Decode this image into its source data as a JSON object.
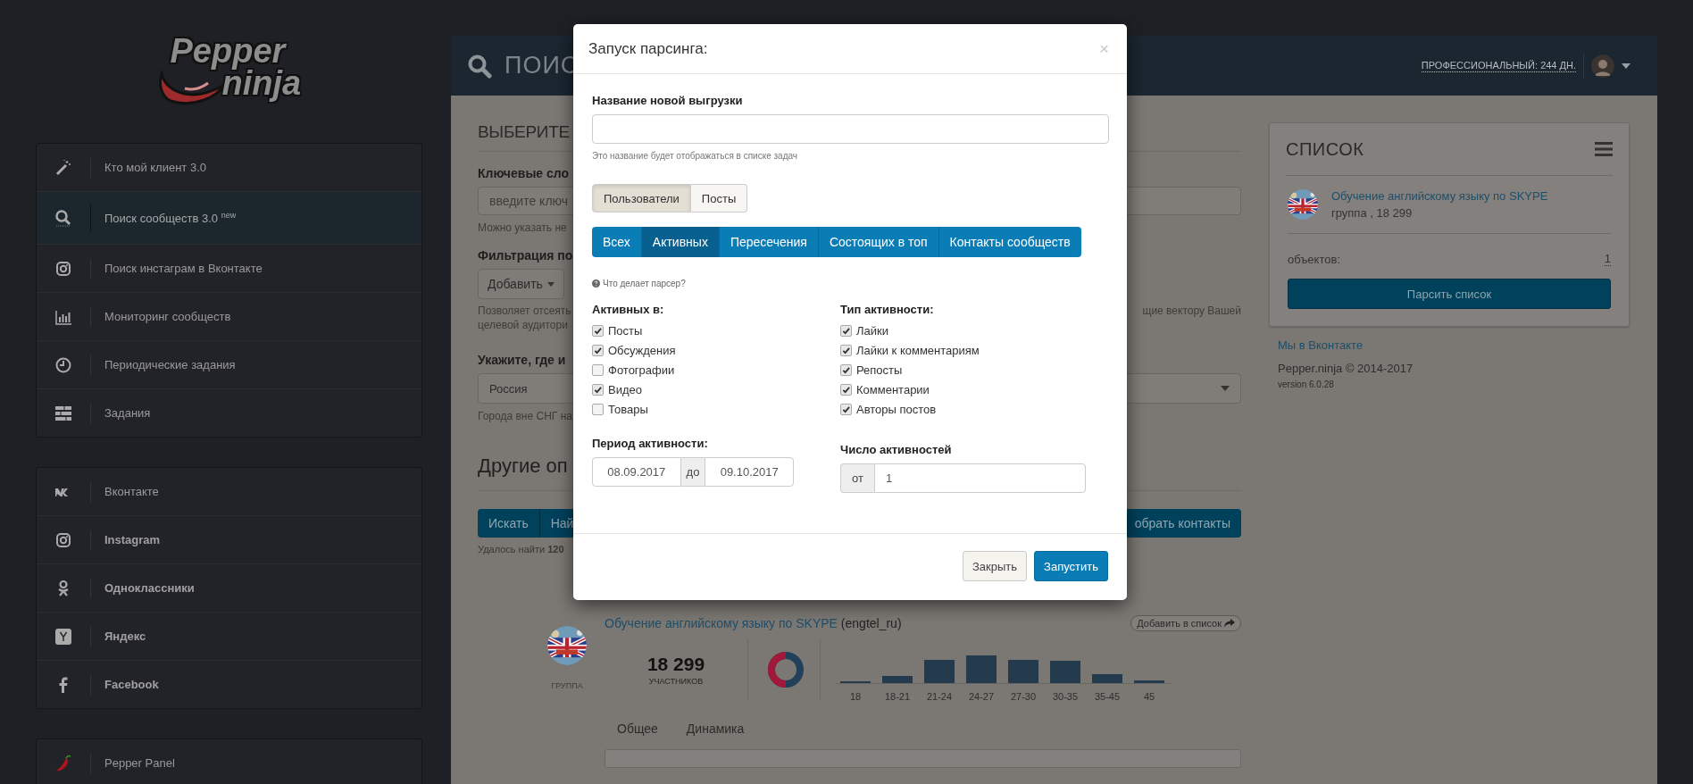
{
  "sidebar": {
    "logo": {
      "line_1": "Pepper",
      "line_2": "ninja"
    },
    "groups": [
      {
        "items": [
          {
            "label": "Кто мой клиент 3.0",
            "selected": false,
            "emphasized": false
          },
          {
            "label": "Поиск сообществ 3.0 $^{new}$",
            "selected": true,
            "emphasized": false
          },
          {
            "label": "Поиск инстаграм в Вконтакте",
            "selected": false,
            "emphasized": false
          },
          {
            "label": "Мониторинг сообществ",
            "selected": false,
            "emphasized": false
          },
          {
            "label": "Периодические задания",
            "selected": false,
            "emphasized": false
          },
          {
            "label": "Задания",
            "selected": false,
            "emphasized": false
          }
        ]
      },
      {
        "items": [
          {
            "label": "Вконтакте",
            "selected": false,
            "emphasized": false
          },
          {
            "label": "Instagram",
            "selected": false,
            "emphasized": true
          },
          {
            "label": "Одноклассники",
            "selected": false,
            "emphasized": true
          },
          {
            "label": "Яндекс",
            "selected": false,
            "emphasized": true
          },
          {
            "label": "Facebook",
            "selected": false,
            "emphasized": true
          }
        ]
      },
      {
        "items": [
          {
            "label": "Pepper Panel",
            "selected": false,
            "emphasized": false
          }
        ]
      }
    ]
  },
  "header": {
    "title": "ПОИС",
    "plan": "ПРОФЕССИОНАЛЬНЫЙ: 244 ДН."
  },
  "search_form": {
    "heading": "ВЫБЕРИТЕ",
    "keywords_label": "Ключевые сло",
    "keywords_placeholder": "введите ключ",
    "keywords_help": "Можно указать не",
    "filter_label": "Фильтрация по",
    "filter_button": "Добавить",
    "filter_help_left": [
      "Позволяет отсеять",
      "целевой аудитори"
    ],
    "filter_help_right": "щие вектору Вашей",
    "region_label": "Укажите, где и",
    "region_value": "Россия",
    "region_help": "Города вне СНГ на",
    "other_heading": "Другие оп",
    "actions": [
      "Искать",
      "Най"
    ],
    "contacts_button": "обрать контакты",
    "found": "Удалось найти **120**"
  },
  "result": {
    "title": "Обучение английскому языку по SKYPE",
    "handle": "(engtel_ru)",
    "add_button": "Добавить в список",
    "type": "ГРУППА",
    "members": "18 299",
    "members_label": "УЧАСТНИКОВ",
    "age_labels": [
      "18",
      "18-21",
      "21-24",
      "24-27",
      "27-30",
      "30-35",
      "35-45",
      "45"
    ],
    "tabs": [
      "Общее",
      "Динамика"
    ]
  },
  "list_panel": {
    "title": "СПИСОК",
    "items": [
      {
        "title": "Обучение английскому языку по SKYPE",
        "meta": "группа , 18 299"
      }
    ],
    "count_label": "объектов:",
    "count": "1",
    "parse_button": "Парсить список"
  },
  "footer": {
    "vk_link": "Мы в Вконтакте",
    "copyright": "Pepper.ninja © 2014-2017",
    "version": "version 6.0.28"
  },
  "modal": {
    "title": "Запуск парсинга:",
    "close": "×",
    "name_label": "Название новой выгрузки",
    "name_help": "Это название будет отображаться в списке задач",
    "modes": [
      {
        "label": "Пользователи",
        "selected": true
      },
      {
        "label": "Посты",
        "selected": false
      }
    ],
    "tabs": [
      {
        "label": "Всех",
        "selected": false
      },
      {
        "label": "Активных",
        "selected": true
      },
      {
        "label": "Пересечения",
        "selected": false
      },
      {
        "label": "Состоящих в топ",
        "selected": false
      },
      {
        "label": "Контакты сообществ",
        "selected": false
      }
    ],
    "help_link": "Что делает парсер?",
    "groups": [
      {
        "title": "Активных в:",
        "options": [
          {
            "label": "Посты",
            "checked": true
          },
          {
            "label": "Обсуждения",
            "checked": true
          },
          {
            "label": "Фотографии",
            "checked": false
          },
          {
            "label": "Видео",
            "checked": true
          },
          {
            "label": "Товары",
            "checked": false
          }
        ]
      },
      {
        "title": "Тип активности:",
        "options": [
          {
            "label": "Лайки",
            "checked": true
          },
          {
            "label": "Лайки к комментариям",
            "checked": true
          },
          {
            "label": "Репосты",
            "checked": true
          },
          {
            "label": "Комментарии",
            "checked": true
          },
          {
            "label": "Авторы постов",
            "checked": true
          }
        ]
      }
    ],
    "period": {
      "label": "Период активности:",
      "from": "08.09.2017",
      "separator": "до",
      "to": "09.10.2017"
    },
    "count": {
      "label": "Число активностей",
      "prefix": "от",
      "value": "1"
    },
    "buttons": [
      {
        "label": "Закрыть",
        "kind": "default"
      },
      {
        "label": "Запустить",
        "kind": "primary"
      }
    ]
  }
}
